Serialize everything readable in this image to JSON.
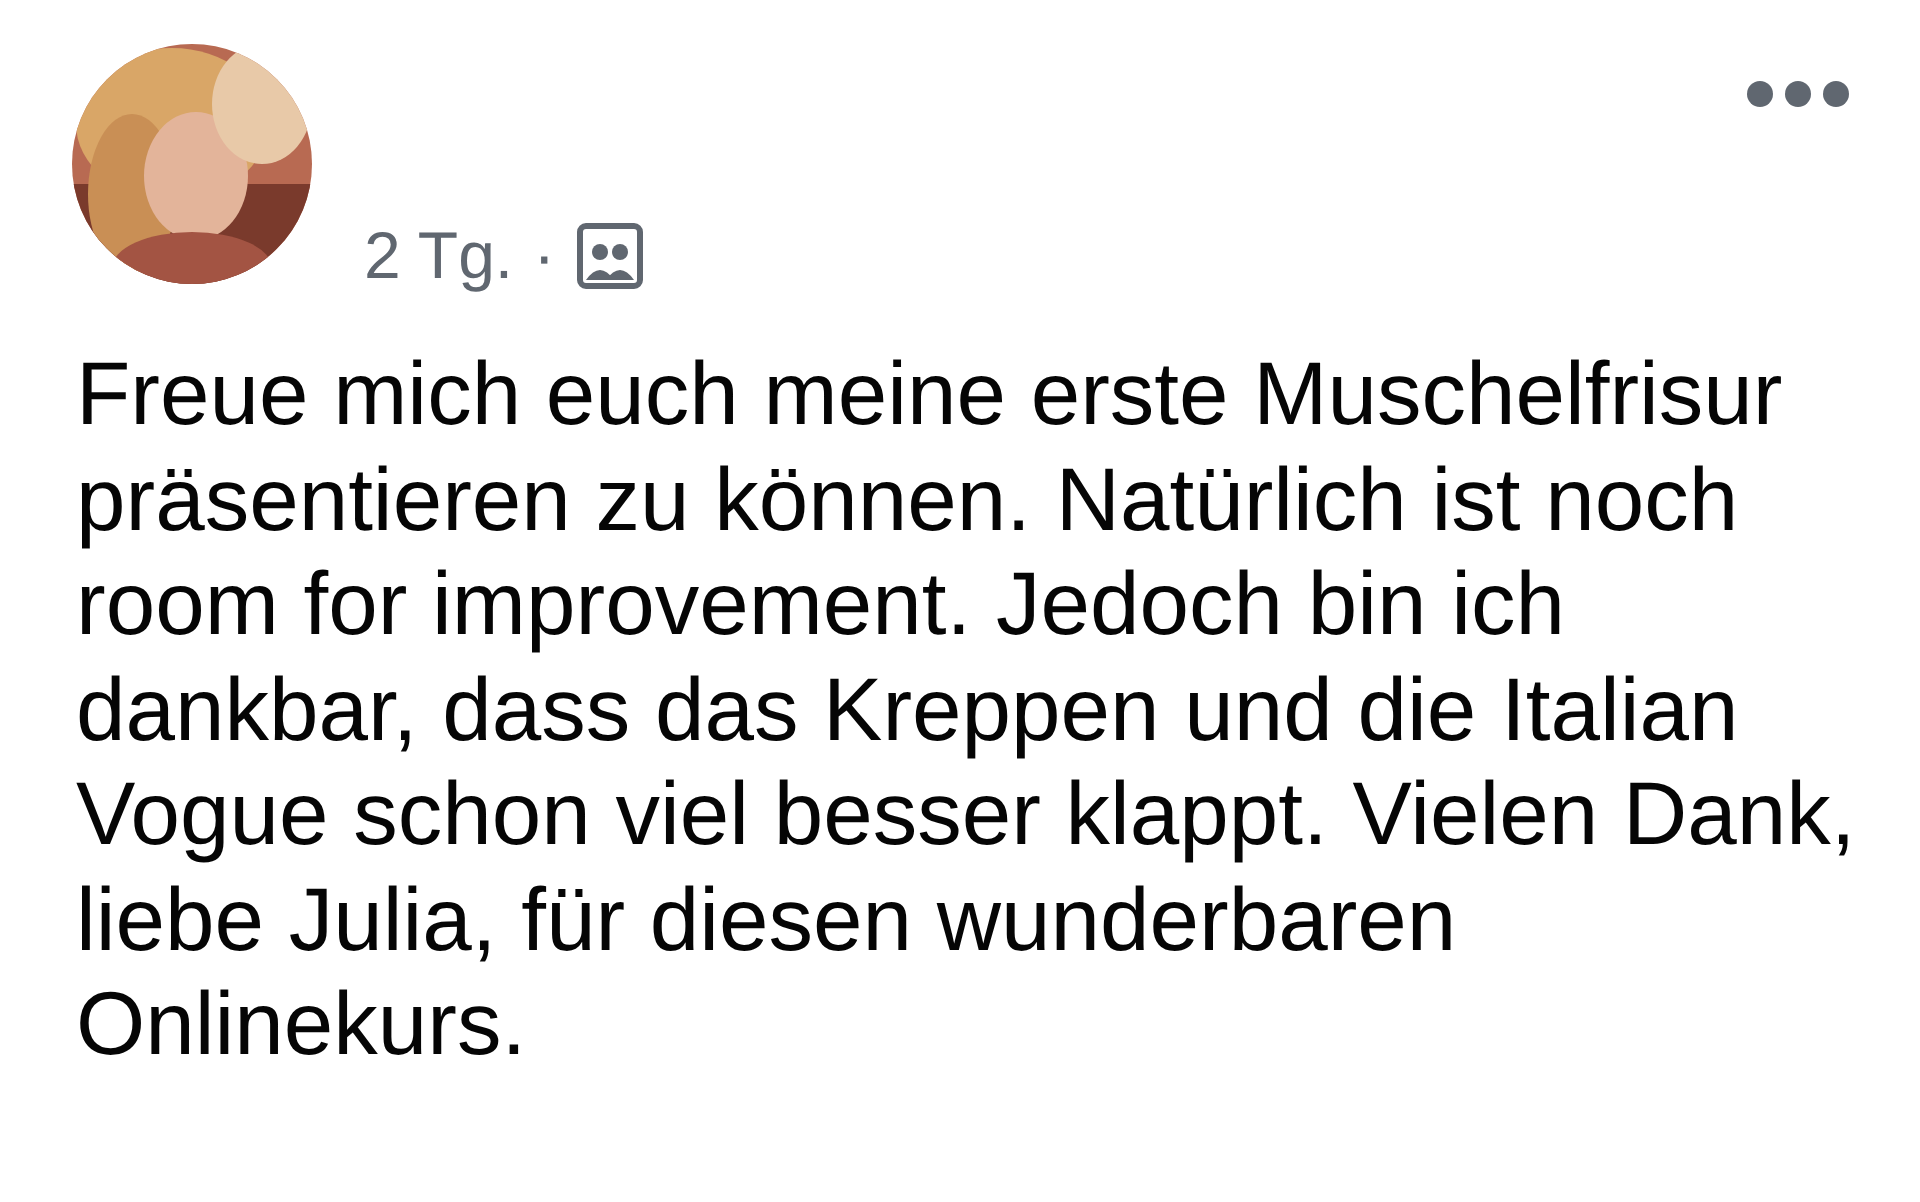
{
  "post": {
    "time": "2 Tg.",
    "separator": "·",
    "text": "Freue mich euch meine erste Muschelfrisur präsentieren zu können. Natürlich ist noch room for improvement. Jedoch bin ich dankbar, dass das Kreppen und die Italian Vogue schon viel besser klappt. Vielen Dank, liebe Julia, für diesen wunderbaren Onlinekurs."
  }
}
